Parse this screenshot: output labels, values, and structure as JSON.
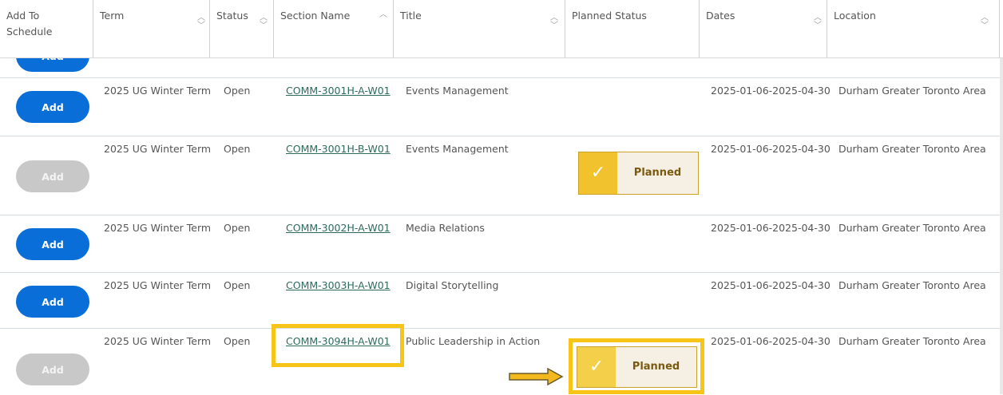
{
  "header": {
    "add_to_schedule": "Add To Schedule",
    "term": "Term",
    "status": "Status",
    "section_name": "Section Name",
    "title": "Title",
    "planned_status": "Planned Status",
    "dates": "Dates",
    "location": "Location"
  },
  "partial_button": "Add",
  "rows": [
    {
      "button": "Add",
      "button_enabled": true,
      "term": "2025 UG Winter Term",
      "status": "Open",
      "section": "COMM-3001H-A-W01",
      "title": "Events Management",
      "planned": "",
      "dates": "2025-01-06-2025-04-30",
      "location": "Durham Greater Toronto Area"
    },
    {
      "button": "Add",
      "button_enabled": false,
      "term": "2025 UG Winter Term",
      "status": "Open",
      "section": "COMM-3001H-B-W01",
      "title": "Events Management",
      "planned": "Planned",
      "dates": "2025-01-06-2025-04-30",
      "location": "Durham Greater Toronto Area"
    },
    {
      "button": "Add",
      "button_enabled": true,
      "term": "2025 UG Winter Term",
      "status": "Open",
      "section": "COMM-3002H-A-W01",
      "title": "Media Relations",
      "planned": "",
      "dates": "2025-01-06-2025-04-30",
      "location": "Durham Greater Toronto Area"
    },
    {
      "button": "Add",
      "button_enabled": true,
      "term": "2025 UG Winter Term",
      "status": "Open",
      "section": "COMM-3003H-A-W01",
      "title": "Digital Storytelling",
      "planned": "",
      "dates": "2025-01-06-2025-04-30",
      "location": "Durham Greater Toronto Area"
    },
    {
      "button": "Add",
      "button_enabled": false,
      "term": "2025 UG Winter Term",
      "status": "Open",
      "section": "COMM-3094H-A-W01",
      "title": "Public Leadership in Action",
      "planned": "Planned",
      "dates": "2025-01-06-2025-04-30",
      "location": "Durham Greater Toronto Area"
    }
  ],
  "colors": {
    "add_button": "#0a6ed8",
    "disabled_button": "#c8c8c8",
    "planned_accent": "#f2c12e",
    "highlight": "#f7c518",
    "link": "#2e6b5a"
  },
  "icons": {
    "sort": "sort-arrows-icon",
    "check": "check-icon",
    "arrow": "right-arrow-icon"
  }
}
